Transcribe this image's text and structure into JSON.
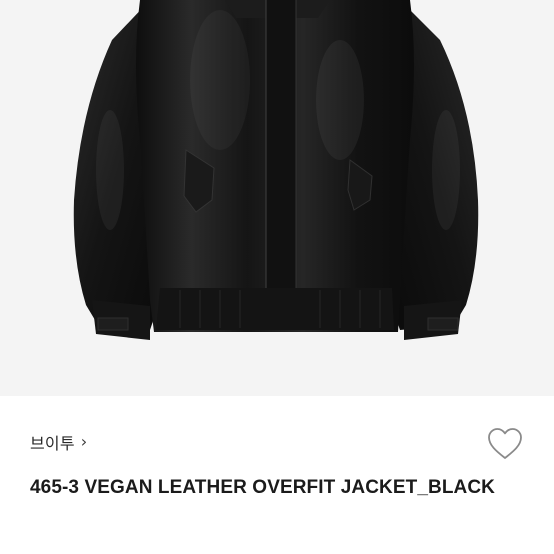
{
  "product": {
    "image_alt": "Black vegan leather overfit jacket",
    "shop_name": "브이투",
    "shop_chevron": "›",
    "title": "465-3 VEGAN LEATHER OVERFIT JACKET_BLACK"
  },
  "icons": {
    "wishlist": "heart-outline-icon",
    "shop_link": "chevron-right-icon"
  },
  "colors": {
    "background": "#ffffff",
    "image_background": "#f4f4f4",
    "jacket": "#1a1a1a",
    "text": "#1b1b1b",
    "icon": "#8a8a8a"
  }
}
